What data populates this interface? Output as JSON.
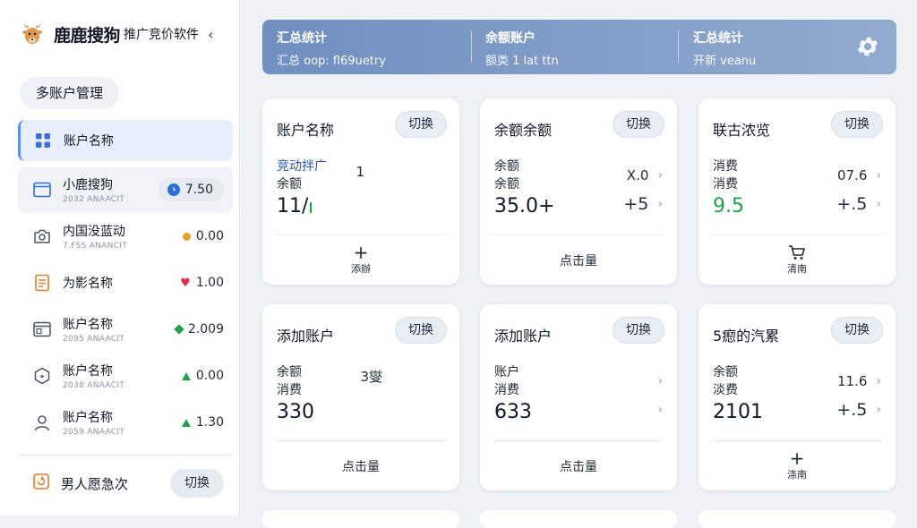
{
  "brand": {
    "name": "鹿鹿搜狗",
    "subtitle": "推广竞价软件",
    "collapse": "‹"
  },
  "sidebar": {
    "multi_account": "多账户管理",
    "items": [
      {
        "name": "账户名称",
        "sub": "",
        "value": ""
      },
      {
        "name": "小鹿搜狗",
        "sub": "2032 ANAACIT",
        "value": "7.50"
      },
      {
        "name": "内国没蓝动",
        "sub": "7.FSS ANANCIT",
        "value": "0.00"
      },
      {
        "name": "为影名称",
        "sub": "",
        "value": "1.00"
      },
      {
        "name": "账户名称",
        "sub": "2095 ANAACIT",
        "value": "2.009"
      },
      {
        "name": "账户名称",
        "sub": "2038 ANAACIT",
        "value": "0.00"
      },
      {
        "name": "账户名称",
        "sub": "2059 ANAACIT",
        "value": "1.30"
      }
    ],
    "bottom": {
      "name": "男人愿急次",
      "switch": "切换"
    }
  },
  "banner": {
    "sections": [
      {
        "title": "汇总统计",
        "sub": "汇总 oop: fl69uetry"
      },
      {
        "title": "余额账户",
        "sub": "额类 1 lat ttn"
      },
      {
        "title": "汇总统计",
        "sub": "开新 veanu"
      }
    ]
  },
  "cards": [
    {
      "title": "账户名称",
      "switch": "切换",
      "l1": "竞动拌广",
      "l2": "余额",
      "big": "11/",
      "r1": "1",
      "r2": "",
      "foot_icon": "+",
      "foot": "添辦"
    },
    {
      "title": "余额余额",
      "switch": "切换",
      "l1": "余额",
      "l2": "余额",
      "big": "35.0+",
      "r1": "X.0",
      "r2": "+5",
      "foot_icon": "",
      "foot": "点击量"
    },
    {
      "title": "联古浓览",
      "switch": "切换",
      "l1": "消费",
      "l2": "消费",
      "big": "9.5",
      "r1": "07.6",
      "r2": "+.5",
      "foot_icon": "cart",
      "foot": "清南"
    },
    {
      "title": "添加账户",
      "switch": "切换",
      "l1": "余额",
      "l2": "消费",
      "big": "330",
      "r1": "3燮",
      "r2": "",
      "foot_icon": "",
      "foot": "点击量"
    },
    {
      "title": "添加账户",
      "switch": "切换",
      "l1": "账户",
      "l2": "消费",
      "big": "633",
      "r1": "",
      "r2": "",
      "foot_icon": "",
      "foot": "点击量"
    },
    {
      "title": "5瘛的汽累",
      "switch": "切换",
      "l1": "余额",
      "l2": "淡费",
      "big": "2101",
      "r1": "11.6",
      "r2": "+.5",
      "foot_icon": "+",
      "foot": "涤南"
    }
  ]
}
